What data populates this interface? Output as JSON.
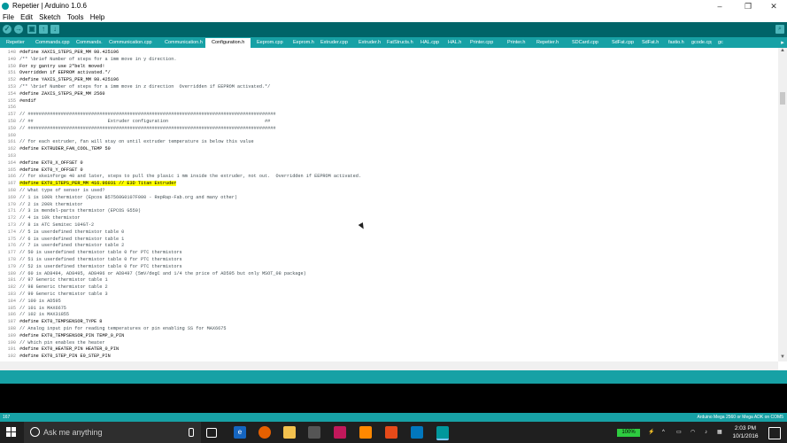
{
  "window": {
    "title": "Repetier | Arduino 1.0.6",
    "minimize": "–",
    "maximize": "❐",
    "close": "✕"
  },
  "menu": [
    "File",
    "Edit",
    "Sketch",
    "Tools",
    "Help"
  ],
  "toolbar": {
    "verify": "✓",
    "upload": "→",
    "new": "▣",
    "open": "↑",
    "save": "↓",
    "serial_monitor": "⌕"
  },
  "tabs": [
    {
      "label": "Repetier",
      "active": false
    },
    {
      "label": "Commands.cpp",
      "active": false
    },
    {
      "label": "Commands.h",
      "active": false
    },
    {
      "label": "Communication.cpp",
      "active": false
    },
    {
      "label": "Communication.h",
      "active": false
    },
    {
      "label": "Configuration.h",
      "active": true
    },
    {
      "label": "Eeprom.cpp",
      "active": false
    },
    {
      "label": "Eeprom.h",
      "active": false
    },
    {
      "label": "Extruder.cpp",
      "active": false
    },
    {
      "label": "Extruder.h",
      "active": false
    },
    {
      "label": "FatStructs.h",
      "active": false
    },
    {
      "label": "HAL.cpp",
      "active": false
    },
    {
      "label": "HAL.h",
      "active": false
    },
    {
      "label": "Printer.cpp",
      "active": false
    },
    {
      "label": "Printer.h",
      "active": false
    },
    {
      "label": "Repetier.h",
      "active": false
    },
    {
      "label": "SDCard.cpp",
      "active": false
    },
    {
      "label": "SdFat.cpp",
      "active": false
    },
    {
      "label": "SdFat.h",
      "active": false
    },
    {
      "label": "fastio.h",
      "active": false
    },
    {
      "label": "gcode.cpp",
      "active": false
    },
    {
      "label": "gco",
      "active": false
    }
  ],
  "tab_more": "▸",
  "code_lines": [
    {
      "n": "148",
      "t": "#define XAXIS_STEPS_PER_MM 98.425196"
    },
    {
      "n": "149",
      "t": "/** \\brief Number of steps for a 1mm move in y direction."
    },
    {
      "n": "150",
      "t": "For xy gantry use 2*belt moved!"
    },
    {
      "n": "151",
      "t": "Overridden if EEPROM activated.*/"
    },
    {
      "n": "152",
      "t": "#define YAXIS_STEPS_PER_MM 98.425196"
    },
    {
      "n": "153",
      "t": "/** \\brief Number of steps for a 1mm move in z direction  Overridden if EEPROM activated.*/"
    },
    {
      "n": "154",
      "t": "#define ZAXIS_STEPS_PER_MM 2560"
    },
    {
      "n": "155",
      "t": "#endif"
    },
    {
      "n": "156",
      "t": ""
    },
    {
      "n": "157",
      "t": "// ##########################################################################################"
    },
    {
      "n": "158",
      "t": "// ##                           Extruder configuration                                   ##"
    },
    {
      "n": "159",
      "t": "// ##########################################################################################"
    },
    {
      "n": "160",
      "t": ""
    },
    {
      "n": "161",
      "t": "// for each extruder, fan will stay on until extruder temperature is below this value"
    },
    {
      "n": "162",
      "t": "#define EXTRUDER_FAN_COOL_TEMP 50"
    },
    {
      "n": "163",
      "t": ""
    },
    {
      "n": "164",
      "t": "#define EXT0_X_OFFSET 0"
    },
    {
      "n": "165",
      "t": "#define EXT0_Y_OFFSET 0"
    },
    {
      "n": "166",
      "t": "// for skeinforge 40 and later, steps to pull the plasic 1 mm inside the extruder, not out.  Overridden if EEPROM activated."
    },
    {
      "n": "167",
      "t": "#define EXT0_STEPS_PER_MM 416.96031 // E3D Titan Extruder",
      "hl": true
    },
    {
      "n": "168",
      "t": "// What type of sensor is used?"
    },
    {
      "n": "169",
      "t": "// 1 is 100k thermistor (Epcos B57560G0107F000 - RepRap-Fab.org and many other)"
    },
    {
      "n": "170",
      "t": "// 2 is 200k thermistor"
    },
    {
      "n": "171",
      "t": "// 3 is mendel-parts thermistor (EPCOS G550)"
    },
    {
      "n": "172",
      "t": "// 4 is 10k thermistor"
    },
    {
      "n": "173",
      "t": "// 8 is ATC Semitec 104GT-2"
    },
    {
      "n": "174",
      "t": "// 5 is userdefined thermistor table 0"
    },
    {
      "n": "175",
      "t": "// 6 is userdefined thermistor table 1"
    },
    {
      "n": "176",
      "t": "// 7 is userdefined thermistor table 2"
    },
    {
      "n": "177",
      "t": "// 50 is userdefined thermistor table 0 for PTC thermistors"
    },
    {
      "n": "178",
      "t": "// 51 is userdefined thermistor table 0 for PTC thermistors"
    },
    {
      "n": "179",
      "t": "// 52 is userdefined thermistor table 0 for PTC thermistors"
    },
    {
      "n": "180",
      "t": "// 60 is AD8494, AD8495, AD8496 or AD8497 (5mV/degC and 1/4 the price of AD595 but only MSOT_08 package)"
    },
    {
      "n": "181",
      "t": "// 97 Generic thermistor table 1"
    },
    {
      "n": "182",
      "t": "// 98 Generic thermistor table 2"
    },
    {
      "n": "183",
      "t": "// 99 Generic thermistor table 3"
    },
    {
      "n": "184",
      "t": "// 100 is AD595"
    },
    {
      "n": "185",
      "t": "// 101 is MAX6675"
    },
    {
      "n": "186",
      "t": "// 102 is MAX31855"
    },
    {
      "n": "187",
      "t": "#define EXT0_TEMPSENSOR_TYPE 8"
    },
    {
      "n": "188",
      "t": "// Analog input pin for reading temperatures or pin enabling SS for MAX6675"
    },
    {
      "n": "189",
      "t": "#define EXT0_TEMPSENSOR_PIN TEMP_0_PIN"
    },
    {
      "n": "190",
      "t": "// Which pin enables the heater"
    },
    {
      "n": "191",
      "t": "#define EXT0_HEATER_PIN HEATER_0_PIN"
    },
    {
      "n": "192",
      "t": "#define EXT0_STEP_PIN E0_STEP_PIN"
    }
  ],
  "status": {
    "line_number": "167",
    "board": "Arduino Mega 2560 or Mega ADK on COM5"
  },
  "taskbar": {
    "search_placeholder": "Ask me anything",
    "battery": "100%",
    "time": "2:03 PM",
    "date": "10/1/2016"
  },
  "colors": {
    "teal_dark": "#006468",
    "teal": "#17a1a5",
    "highlight": "#ffff00"
  }
}
